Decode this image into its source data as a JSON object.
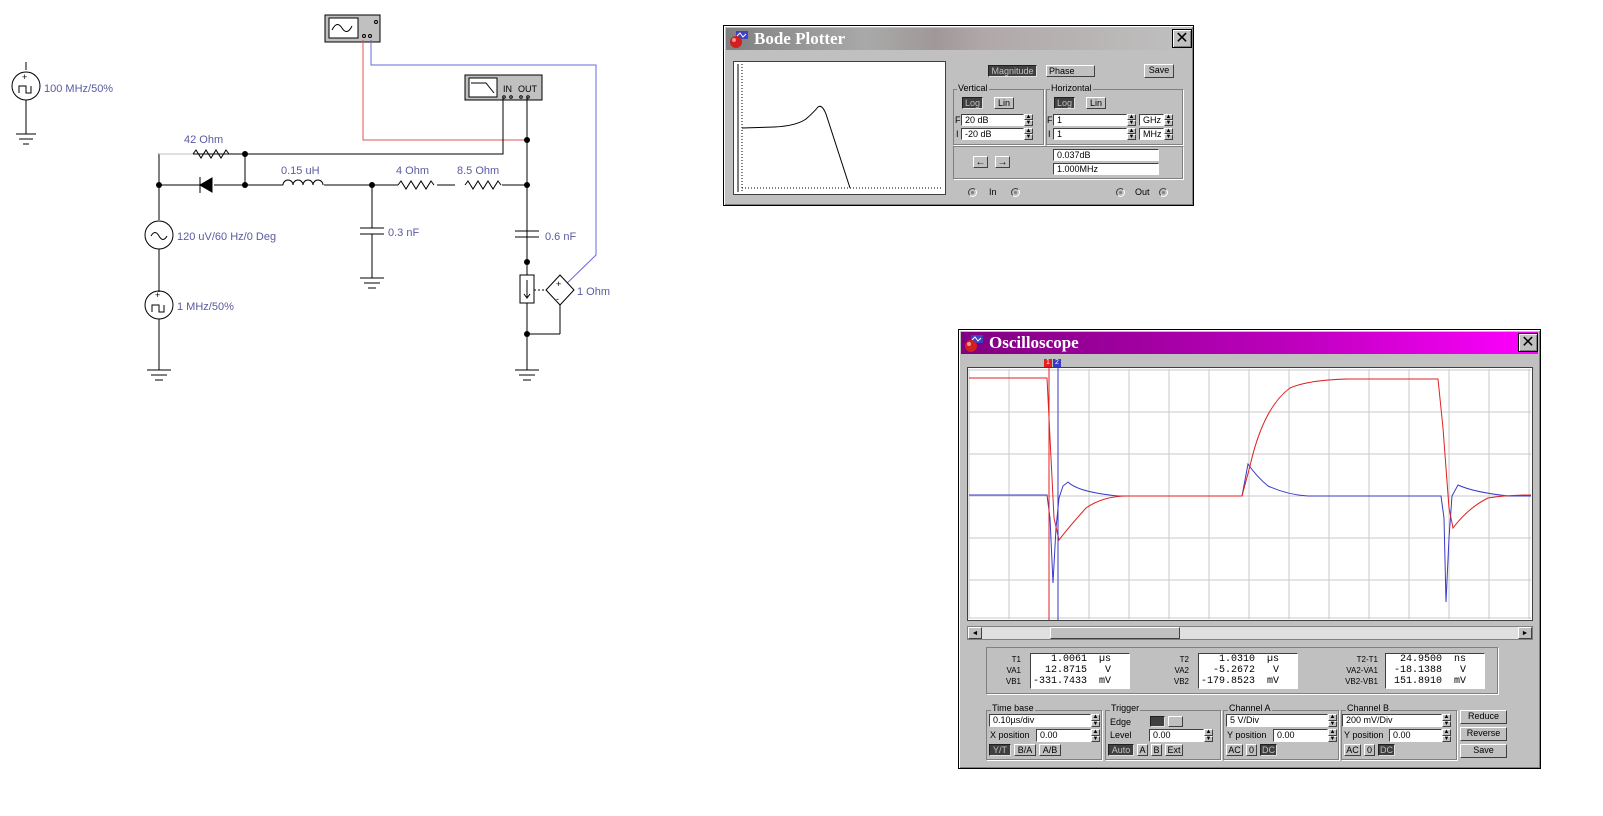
{
  "schematic": {
    "labels": {
      "src_top": "100 MHz/50%",
      "r_top": "42  Ohm",
      "inductor": "0.15 uH",
      "r_mid": "4  Ohm",
      "r_right": "8.5  Ohm",
      "src_ac": "120 uV/60 Hz/0 Deg",
      "cap_mid": "0.3 nF",
      "cap_right": "0.6 nF",
      "dep_src": "1  Ohm",
      "src_pulse": "1 MHz/50%"
    },
    "bode_icon": {
      "in": "IN",
      "out": "OUT"
    }
  },
  "bode": {
    "title": "Bode Plotter",
    "close": "✕",
    "magnitude": "Magnitude",
    "phase": "Phase",
    "save": "Save",
    "vertical": {
      "title": "Vertical",
      "log": "Log",
      "lin": "Lin",
      "f_label": "F",
      "f_value": "20 dB",
      "i_label": "I",
      "i_value": "-20 dB"
    },
    "horizontal": {
      "title": "Horizontal",
      "log": "Log",
      "lin": "Lin",
      "f_label": "F",
      "f_value": "1",
      "f_unit": "GHz",
      "i_label": "I",
      "i_value": "1",
      "i_unit": "MHz"
    },
    "left_arrow": "←",
    "right_arrow": "→",
    "readout_value": "0.037dB",
    "readout_freq": "1.000MHz",
    "in_label": "In",
    "out_label": "Out"
  },
  "scope": {
    "title": "Oscilloscope",
    "close": "✕",
    "scroll_left": "◄",
    "scroll_right": "►",
    "cursor1": "1",
    "cursor2": "2",
    "readouts": {
      "col1": {
        "labels": [
          "T1",
          "VA1",
          "VB1"
        ],
        "values": [
          "   1.0061  µs",
          "  12.8715   V",
          "-331.7433  mV"
        ]
      },
      "col2": {
        "labels": [
          "T2",
          "VA2",
          "VB2"
        ],
        "values": [
          "   1.0310  µs",
          "  -5.2672   V",
          "-179.8523  mV"
        ]
      },
      "col3": {
        "labels": [
          "T2-T1",
          "VA2-VA1",
          "VB2-VB1"
        ],
        "values": [
          "  24.9500  ns",
          " -18.1388   V",
          " 151.8910  mV"
        ]
      }
    },
    "timebase": {
      "title": "Time base",
      "value": "0.10µs/div",
      "xpos_label": "X position",
      "xpos_value": "0.00",
      "yt": "Y/T",
      "ba": "B/A",
      "ab": "A/B"
    },
    "trigger": {
      "title": "Trigger",
      "edge_label": "Edge",
      "level_label": "Level",
      "level_value": "0.00",
      "auto": "Auto",
      "a": "A",
      "b": "B",
      "ext": "Ext"
    },
    "channel_a": {
      "title": "Channel A",
      "value": "5  V/Div",
      "ypos_label": "Y position",
      "ypos_value": "0.00",
      "ac": "AC",
      "zero": "0",
      "dc": "DC"
    },
    "channel_b": {
      "title": "Channel B",
      "value": "200 mV/Div",
      "ypos_label": "Y position",
      "ypos_value": "0.00",
      "ac": "AC",
      "zero": "0",
      "dc": "DC"
    },
    "buttons": {
      "reduce": "Reduce",
      "reverse": "Reverse",
      "save": "Save"
    }
  }
}
